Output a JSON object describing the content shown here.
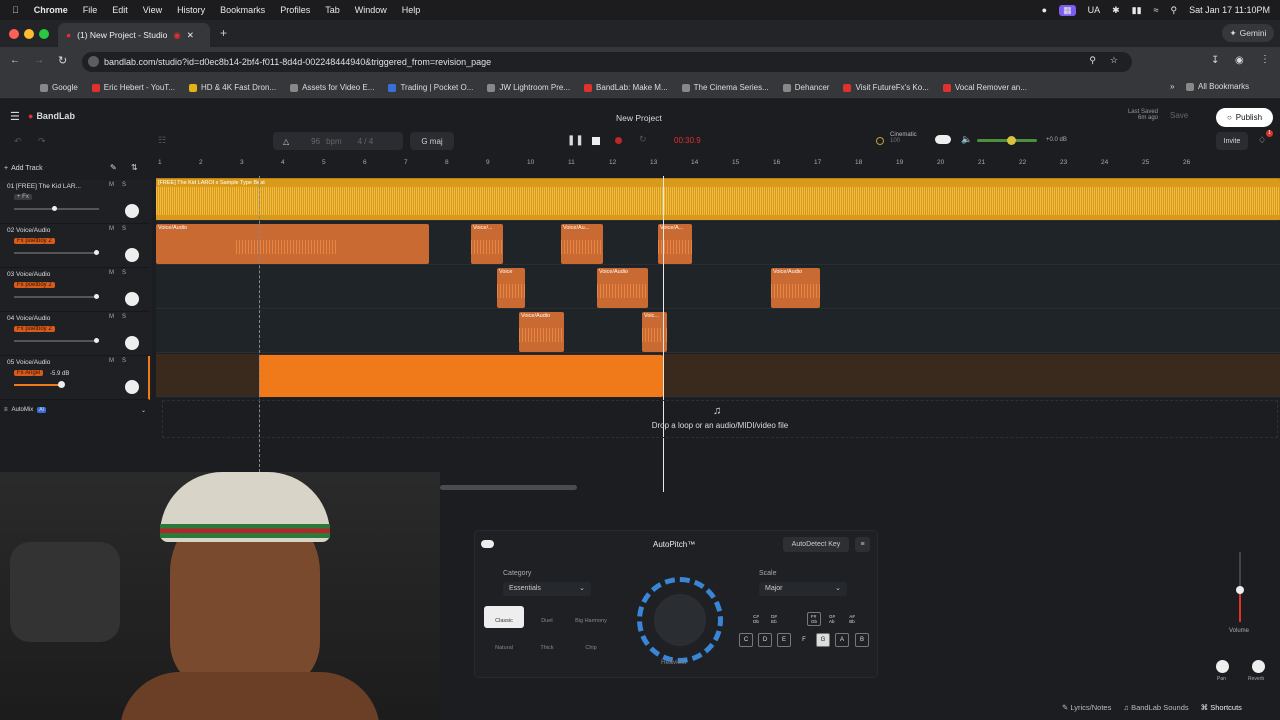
{
  "macos": {
    "app": "Chrome",
    "menus": [
      "File",
      "Edit",
      "View",
      "History",
      "Bookmarks",
      "Profiles",
      "Tab",
      "Window",
      "Help"
    ],
    "input_source": "UA",
    "clock": "Sat Jan 17  11:10PM"
  },
  "browser": {
    "tab_title": "(1) New Project - Studio",
    "url": "bandlab.com/studio?id=d0ec8b14-2bf4-f011-8d4d-002248444940&triggered_from=revision_page",
    "gemini_label": "Gemini",
    "bookmarks": [
      "Google",
      "Eric Hebert - YouT...",
      "HD & 4K Fast Dron...",
      "Assets for Video E...",
      "Trading | Pocket O...",
      "JW Lightroom Pre...",
      "BandLab: Make M...",
      "The Cinema Series...",
      "Dehancer",
      "Visit FutureFx's Ko...",
      "Vocal Remover an..."
    ],
    "all_bookmarks": "All Bookmarks"
  },
  "app": {
    "brand": "BandLab",
    "project_title": "New Project",
    "last_saved_label": "Last Saved",
    "last_saved_value": "6m ago",
    "save_label": "Save",
    "publish_label": "Publish",
    "invite_label": "Invite",
    "notification_count": "1",
    "bpm": "96",
    "bpm_unit": "bpm",
    "time_signature": "4 / 4",
    "key": "G maj",
    "time": "00:30.9",
    "master_preset_name": "Cinematic",
    "master_preset_value": "100",
    "master_volume": "+0.0 dB",
    "add_track": "Add Track",
    "automix": "AutoMix",
    "automix_badge": "AI",
    "drop_hint": "Drop a loop or an audio/MIDI/video file",
    "ruler": [
      "1",
      "2",
      "3",
      "4",
      "5",
      "6",
      "7",
      "8",
      "9",
      "10",
      "11",
      "12",
      "13",
      "14",
      "15",
      "16",
      "17",
      "18",
      "19",
      "20",
      "21",
      "22",
      "23",
      "24",
      "25",
      "26"
    ]
  },
  "tracks": [
    {
      "name": "01  [FREE] The Kid LAR...",
      "fx": "+ Fx",
      "mute": "M",
      "solo": "S"
    },
    {
      "name": "02  Voice/Audio",
      "fx": "Fx poetboy 2",
      "mute": "M",
      "solo": "S"
    },
    {
      "name": "03  Voice/Audio",
      "fx": "Fx poetboy 2",
      "mute": "M",
      "solo": "S"
    },
    {
      "name": "04  Voice/Audio",
      "fx": "Fx poetboy 2",
      "mute": "M",
      "solo": "S"
    },
    {
      "name": "05  Voice/Audio",
      "fx": "Fx Angel",
      "mute": "M",
      "solo": "S",
      "volume_readout": "-5.9 dB"
    }
  ],
  "clips": {
    "beat": "[FREE] The Kid LAROI x Sample Type Beat",
    "voice": "Voice/Audio",
    "voice_short1": "Voice/...",
    "voice_short2": "Voice/Au...",
    "voice_short3": "Voice/A...",
    "voice_short4": "Voice",
    "voice_short5": "Voic..."
  },
  "autopitch": {
    "title": "AutoPitch™",
    "autodetect": "AutoDetect Key",
    "category_label": "Category",
    "category_value": "Essentials",
    "scale_label": "Scale",
    "scale_value": "Major",
    "modes": [
      "Classic",
      "Duet",
      "Big Harmony",
      "Natural",
      "Thick",
      "Chip"
    ],
    "knob_label": "Heaviest",
    "sharps_top": [
      "C#\nDb",
      "D#\nEb",
      "F#\nGb",
      "G#\nAb",
      "A#\nBb"
    ],
    "keys": [
      "C",
      "D",
      "E",
      "F",
      "G",
      "A",
      "B"
    ]
  },
  "mixer": {
    "volume_label": "Volume",
    "pan_label": "Pan",
    "reverb_label": "Reverb"
  },
  "footer": {
    "lyrics": "Lyrics/Notes",
    "sounds": "BandLab Sounds",
    "shortcuts": "Shortcuts"
  },
  "colors": {
    "accent_orange": "#f07a1a",
    "beat_yellow": "#e6a41e",
    "clip_orange": "#c96a32"
  }
}
